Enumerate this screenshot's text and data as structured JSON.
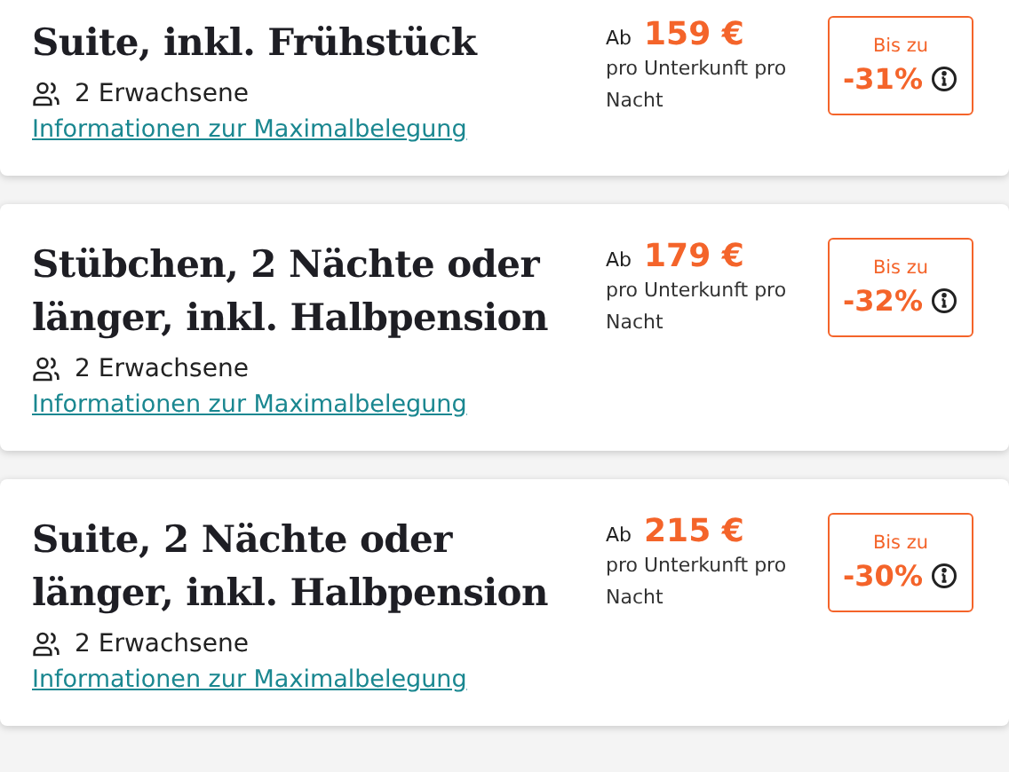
{
  "offers": [
    {
      "title": "Suite, inkl. Frühstück",
      "guests": "2 Erwachsene",
      "info_link": "Informationen zur Maximalbelegung",
      "price_prefix": "Ab",
      "price": "159 €",
      "price_note": "pro Unterkunft pro Nacht",
      "discount_label": "Bis zu",
      "discount": "-31%"
    },
    {
      "title": "Stübchen, 2 Nächte oder länger, inkl. Halbpension",
      "guests": "2 Erwachsene",
      "info_link": "Informationen zur Maximalbelegung",
      "price_prefix": "Ab",
      "price": "179 €",
      "price_note": "pro Unterkunft pro Nacht",
      "discount_label": "Bis zu",
      "discount": "-32%"
    },
    {
      "title": "Suite, 2 Nächte oder länger, inkl. Halbpension",
      "guests": "2 Erwachsene",
      "info_link": "Informationen zur Maximalbelegung",
      "price_prefix": "Ab",
      "price": "215 €",
      "price_note": "pro Unterkunft pro Nacht",
      "discount_label": "Bis zu",
      "discount": "-30%"
    }
  ]
}
